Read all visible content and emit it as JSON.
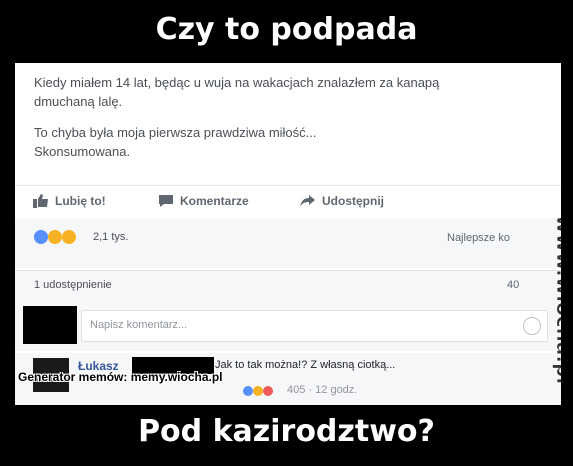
{
  "meme": {
    "top_caption": "Czy to podpada",
    "bottom_caption": "Pod kazirodztwo?"
  },
  "post": {
    "line1": "Kiedy miałem 14 lat, będąc u wuja na wakacjach znalazłem za kanapą",
    "line2": "dmuchaną lalę.",
    "line3": "To chyba była moja pierwsza prawdziwa miłość...",
    "line4": "Skonsumowana."
  },
  "actions": {
    "like": "Lubię to!",
    "comment": "Komentarze",
    "share": "Udostępnij"
  },
  "stats": {
    "reactions_count": "2,1 tys.",
    "best_comments": "Najlepsze ko",
    "shares": "1 udostępnienie",
    "comments_count": "40"
  },
  "comment_box": {
    "placeholder": "Napisz komentarz..."
  },
  "reply": {
    "name": "Łukasz",
    "text": "Jak to tak można!? Z własną ciotką...",
    "reactions": "405",
    "time": "12 godz."
  },
  "overlays": {
    "generator": "Generator memów: memy.wiocha.pl",
    "watermark": "www.wiocha.pl"
  },
  "colors": {
    "like_blue": "#5890ff",
    "haha_yellow": "#f7b125",
    "name_blue": "#365899",
    "watermark": "#333333"
  }
}
